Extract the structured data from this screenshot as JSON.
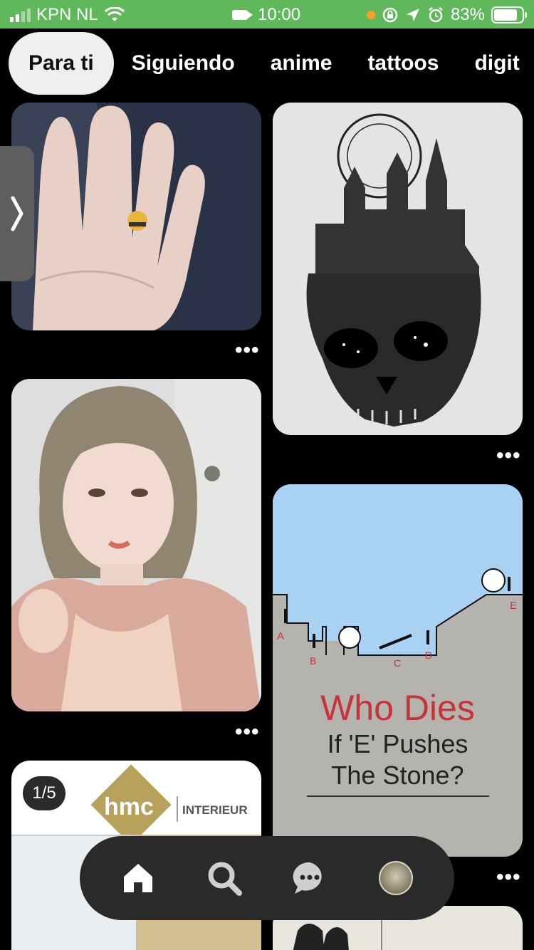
{
  "status_bar": {
    "carrier": "KPN NL",
    "time": "10:00",
    "battery_percent": "83%",
    "battery_level": 0.83
  },
  "tabs": [
    {
      "label": "Para ti",
      "active": true
    },
    {
      "label": "Siguiendo",
      "active": false
    },
    {
      "label": "anime",
      "active": false
    },
    {
      "label": "tattoos",
      "active": false
    },
    {
      "label": "digit",
      "active": false
    }
  ],
  "pins": {
    "more_label": "•••",
    "pin3": {
      "title_line1": "Who Dies",
      "title_line2": "If 'E' Pushes",
      "title_line3": "The Stone?",
      "labels": [
        "A",
        "B",
        "C",
        "D",
        "E"
      ]
    },
    "pin5": {
      "page_badge": "1/5",
      "brand": "hmc",
      "brand_sub": "INTERIEUR"
    }
  },
  "nav": {
    "items": [
      "home-icon",
      "search-icon",
      "messages-icon",
      "profile-avatar"
    ]
  },
  "colors": {
    "status_bar": "#5fb95a",
    "active_tab_bg": "#efefef",
    "title_red": "#c8333a",
    "brand_gold": "#b8a15a"
  }
}
